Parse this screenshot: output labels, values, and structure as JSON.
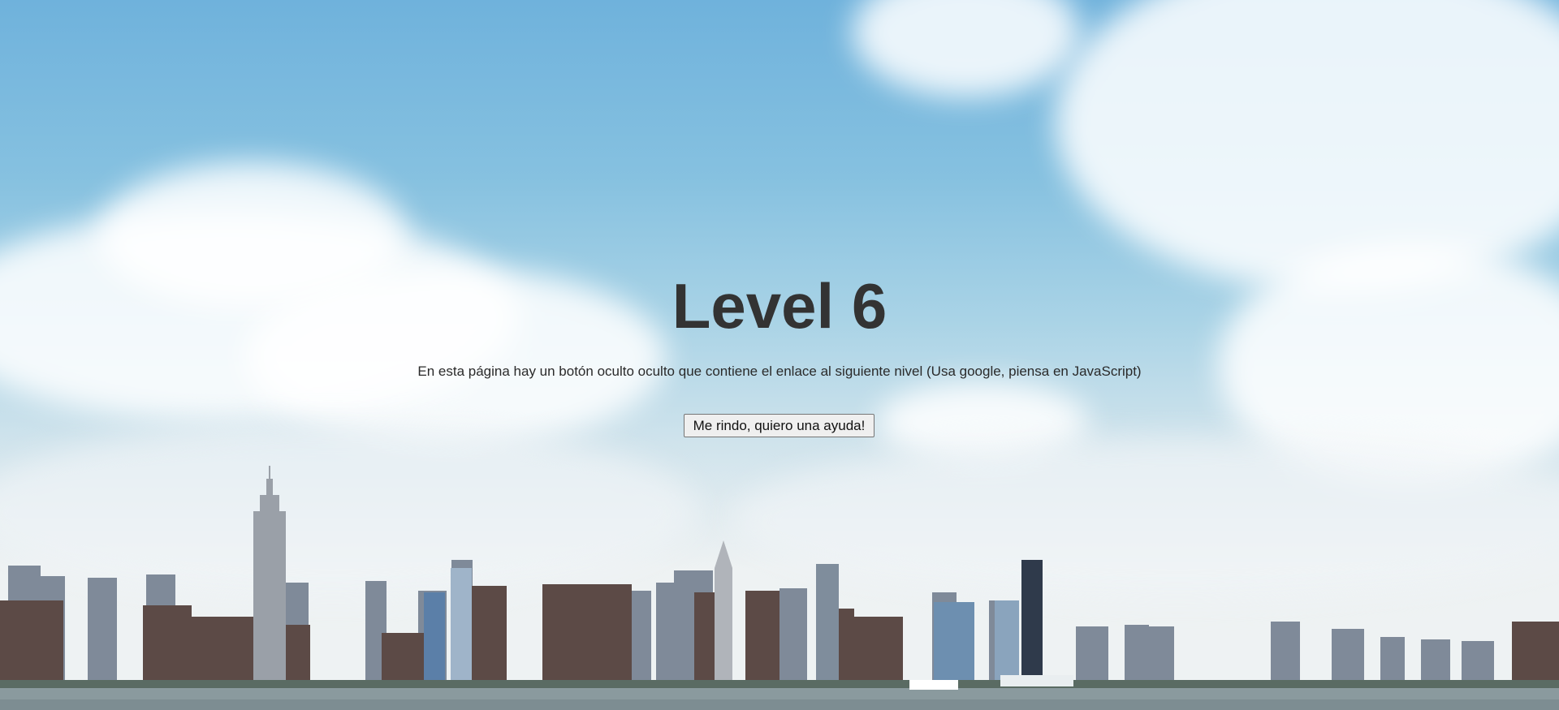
{
  "page": {
    "title": "Level 6",
    "description": "En esta página hay un botón oculto oculto que contiene el enlace al siguiente nivel (Usa google, piensa en JavaScript)",
    "help_button_label": "Me rindo, quiero una ayuda!"
  },
  "colors": {
    "sky_top": "#6fb2dc",
    "sky_bottom": "#eef2f3",
    "text": "#333333"
  }
}
